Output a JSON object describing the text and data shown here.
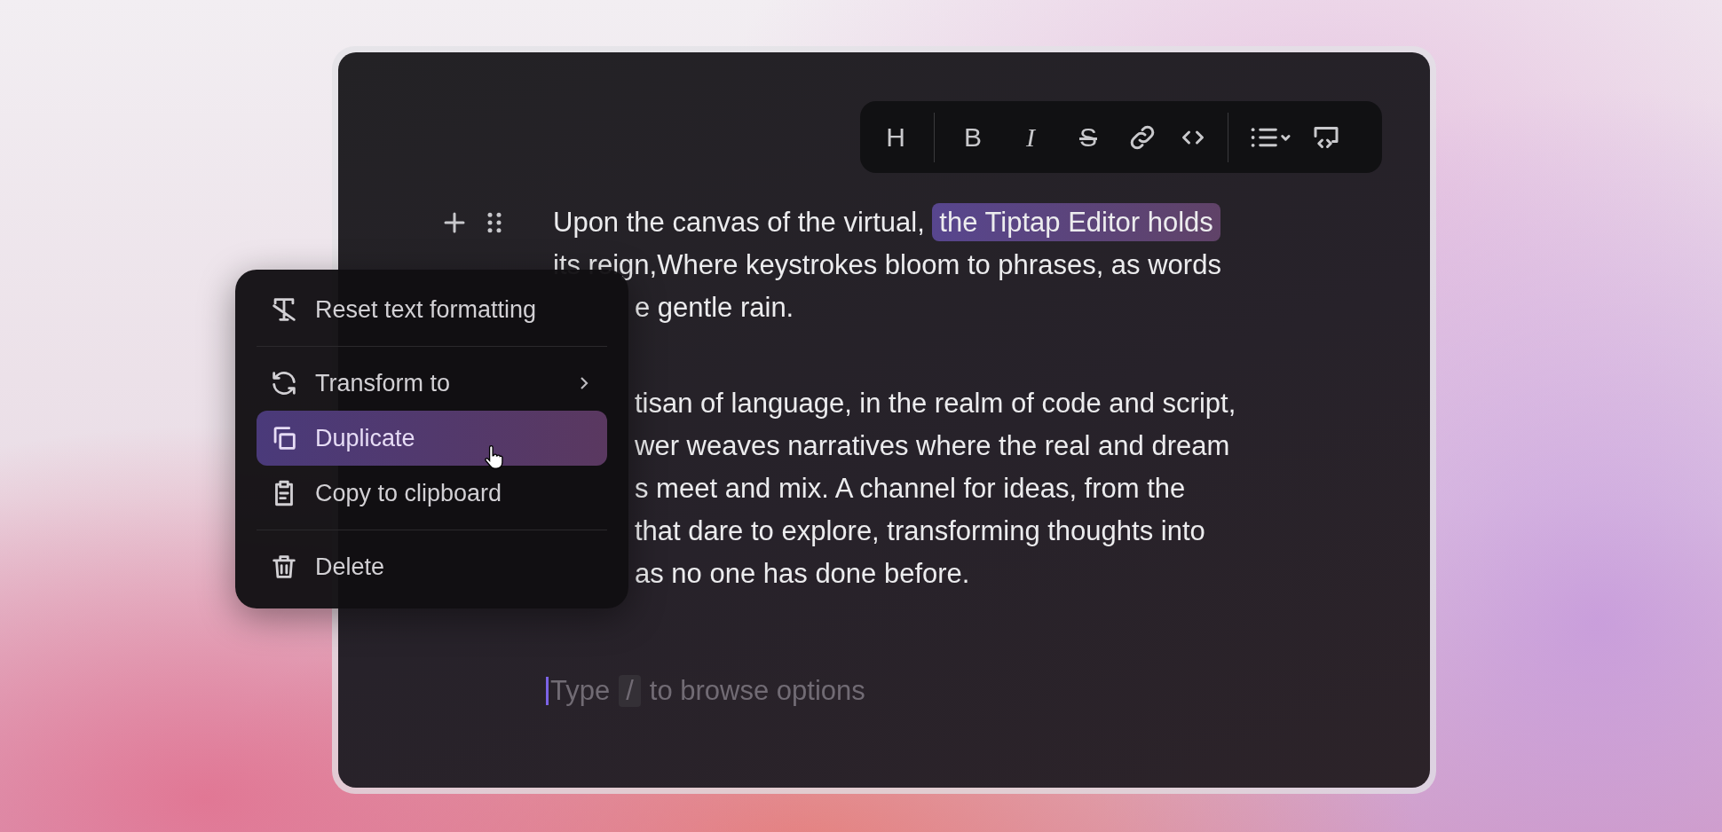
{
  "toolbar": {
    "groups": [
      [
        {
          "kind": "heading",
          "label": "H"
        }
      ],
      [
        {
          "kind": "bold",
          "label": "B"
        },
        {
          "kind": "italic",
          "label": "I"
        },
        {
          "kind": "strike",
          "label": "S"
        },
        {
          "kind": "link"
        },
        {
          "kind": "code"
        }
      ],
      [
        {
          "kind": "list"
        },
        {
          "kind": "codeblock"
        }
      ]
    ]
  },
  "paragraphs": [
    {
      "lines": [
        {
          "covered": false,
          "parts": [
            {
              "text": "Upon the canvas of the virtual, ",
              "highlighted": false
            },
            {
              "text": "the Tiptap Editor holds",
              "highlighted": true
            }
          ]
        },
        {
          "covered": false,
          "parts": [
            {
              "text": "its reign,Where keystrokes bloom to phrases, as words",
              "highlighted": false
            }
          ]
        },
        {
          "covered": true,
          "parts": [
            {
              "text": "e gentle rain.",
              "highlighted": false
            }
          ]
        }
      ]
    },
    {
      "lines": [
        {
          "covered": true,
          "parts": [
            {
              "text": "tisan of language, in the realm of code and script,",
              "highlighted": false
            }
          ]
        },
        {
          "covered": true,
          "parts": [
            {
              "text": "wer weaves narratives where the real and dream",
              "highlighted": false
            }
          ]
        },
        {
          "covered": true,
          "parts": [
            {
              "text": "s meet and mix. A channel for ideas, from the",
              "highlighted": false
            }
          ]
        },
        {
          "covered": true,
          "parts": [
            {
              "text": "that dare to explore, transforming thoughts into",
              "highlighted": false
            }
          ]
        },
        {
          "covered": true,
          "parts": [
            {
              "text": "as no one has done before.",
              "highlighted": false
            }
          ]
        }
      ]
    }
  ],
  "placeholder": {
    "before": "Type",
    "key": "/",
    "after": "to browse options"
  },
  "block_menu": {
    "groups": [
      [
        {
          "kind": "clear-format",
          "label": "Reset text formatting",
          "submenu": false,
          "selected": false
        }
      ],
      [
        {
          "kind": "transform",
          "label": "Transform to",
          "submenu": true,
          "selected": false
        },
        {
          "kind": "duplicate",
          "label": "Duplicate",
          "submenu": false,
          "selected": true
        },
        {
          "kind": "clipboard",
          "label": "Copy to clipboard",
          "submenu": false,
          "selected": false
        }
      ],
      [
        {
          "kind": "delete",
          "label": "Delete",
          "submenu": false,
          "selected": false
        }
      ]
    ]
  }
}
